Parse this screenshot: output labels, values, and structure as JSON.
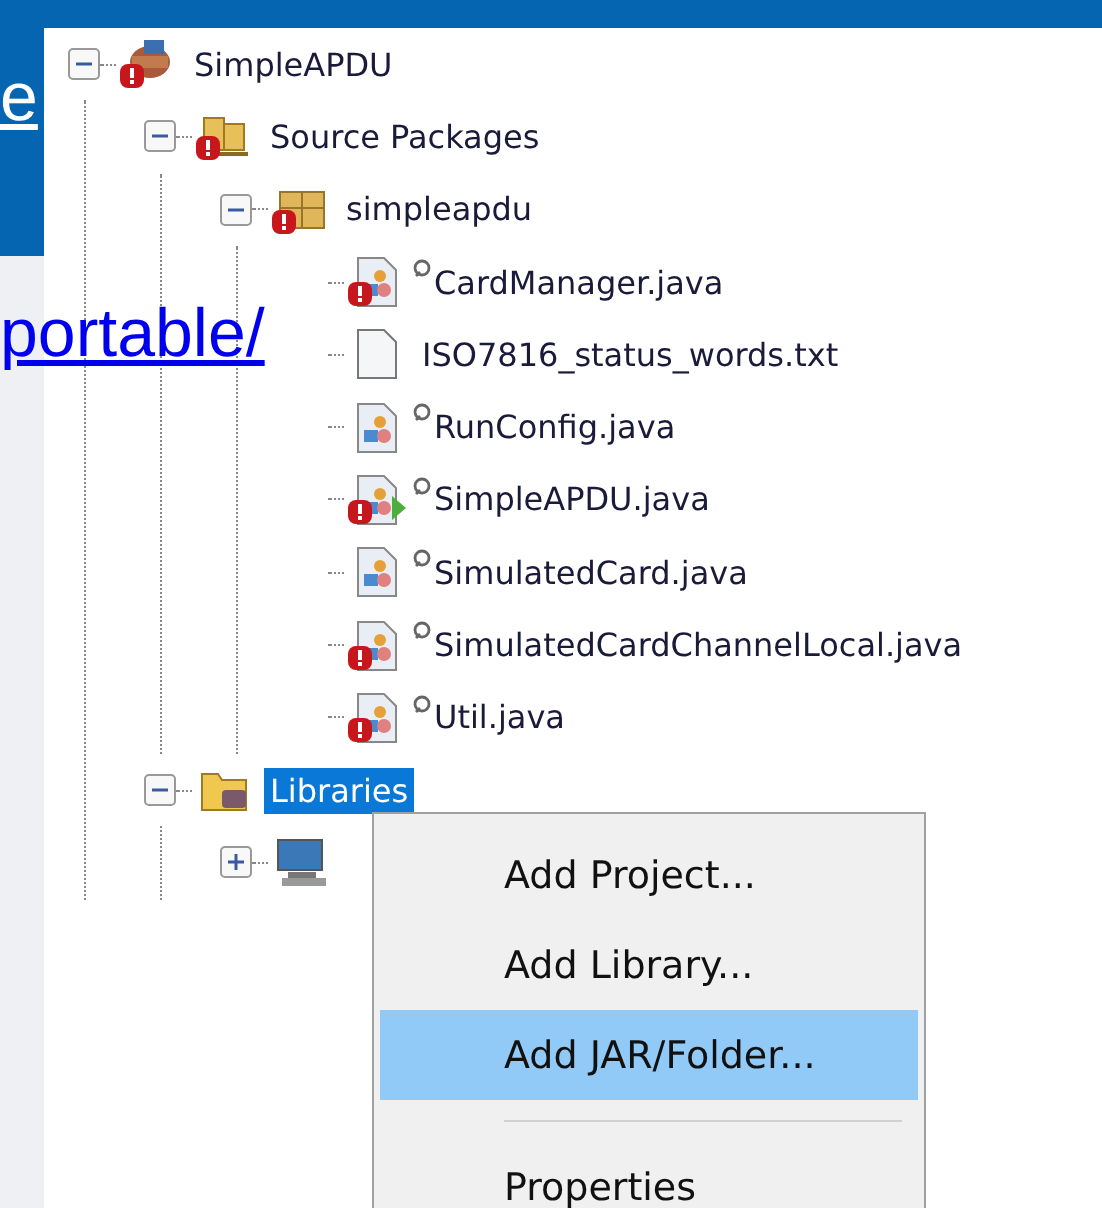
{
  "slide": {
    "heading_fragment": "e",
    "link_fragment": "portable/"
  },
  "tree": [
    {
      "label": "SimpleAPDU",
      "kind": "project",
      "error": true,
      "main": false,
      "annotated": false,
      "expanded": true,
      "selected": false,
      "children": [
        {
          "label": "Source Packages",
          "kind": "source-packages",
          "error": true,
          "main": false,
          "annotated": false,
          "expanded": true,
          "selected": false,
          "children": [
            {
              "label": "simpleapdu",
              "kind": "package",
              "error": true,
              "main": false,
              "annotated": false,
              "expanded": true,
              "selected": false,
              "children": [
                {
                  "label": "CardManager.java",
                  "kind": "java",
                  "error": true,
                  "main": false,
                  "annotated": true,
                  "selected": false
                },
                {
                  "label": "ISO7816_status_words.txt",
                  "kind": "text",
                  "error": false,
                  "main": false,
                  "annotated": false,
                  "selected": false
                },
                {
                  "label": "RunConfig.java",
                  "kind": "java",
                  "error": false,
                  "main": false,
                  "annotated": true,
                  "selected": false
                },
                {
                  "label": "SimpleAPDU.java",
                  "kind": "java",
                  "error": true,
                  "main": true,
                  "annotated": true,
                  "selected": false
                },
                {
                  "label": "SimulatedCard.java",
                  "kind": "java",
                  "error": false,
                  "main": false,
                  "annotated": true,
                  "selected": false
                },
                {
                  "label": "SimulatedCardChannelLocal.java",
                  "kind": "java",
                  "error": true,
                  "main": false,
                  "annotated": true,
                  "selected": false
                },
                {
                  "label": "Util.java",
                  "kind": "java",
                  "error": true,
                  "main": false,
                  "annotated": true,
                  "selected": false
                }
              ]
            }
          ]
        },
        {
          "label": "Libraries",
          "kind": "libraries",
          "error": false,
          "main": false,
          "annotated": false,
          "expanded": true,
          "selected": true,
          "children": [
            {
              "kind": "jdk",
              "error": false,
              "main": false,
              "annotated": false,
              "expanded": false
            }
          ]
        }
      ]
    }
  ],
  "context_menu": [
    {
      "kind": "item",
      "label": "Add Project...",
      "selected": false
    },
    {
      "kind": "item",
      "label": "Add Library...",
      "selected": false
    },
    {
      "kind": "item",
      "label": "Add JAR/Folder...",
      "selected": true
    },
    {
      "kind": "separator"
    },
    {
      "kind": "item",
      "label": "Properties",
      "selected": false
    }
  ]
}
